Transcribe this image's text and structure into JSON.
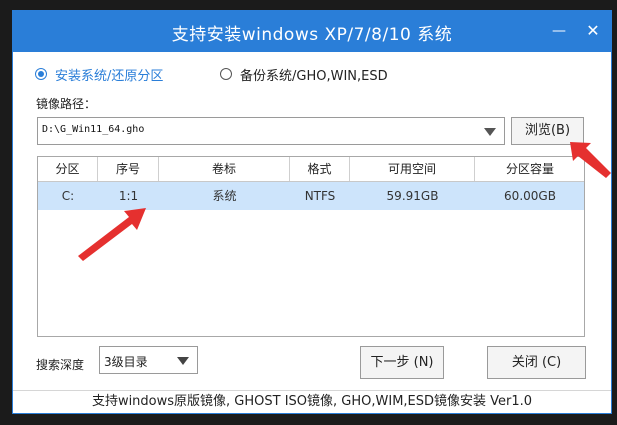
{
  "window": {
    "title": "支持安装windows XP/7/8/10 系统",
    "min_glyph": "—",
    "close_glyph": "✕"
  },
  "mode": {
    "install_label": "安装系统/还原分区",
    "backup_label": "备份系统/GHO,WIN,ESD",
    "selected": "install"
  },
  "image_path": {
    "label": "镜像路径：",
    "value": "D:\\G_Win11_64.gho"
  },
  "browse_button": "浏览(B)",
  "table": {
    "headers": [
      "分区",
      "序号",
      "卷标",
      "格式",
      "可用空间",
      "分区容量"
    ],
    "rows": [
      [
        "C:",
        "1:1",
        "系统",
        "NTFS",
        "59.91GB",
        "60.00GB"
      ]
    ]
  },
  "search_depth": {
    "label": "搜索深度",
    "value": "3级目录"
  },
  "buttons": {
    "next": "下一步 (N)",
    "close": "关闭 (C)"
  },
  "footer": "支持windows原版镜像, GHOST ISO镜像, GHO,WIM,ESD镜像安装 Ver1.0",
  "colors": {
    "accent": "#2a7ed8",
    "selected_row": "#cde4fb",
    "annotation_arrow": "#e5302f"
  }
}
